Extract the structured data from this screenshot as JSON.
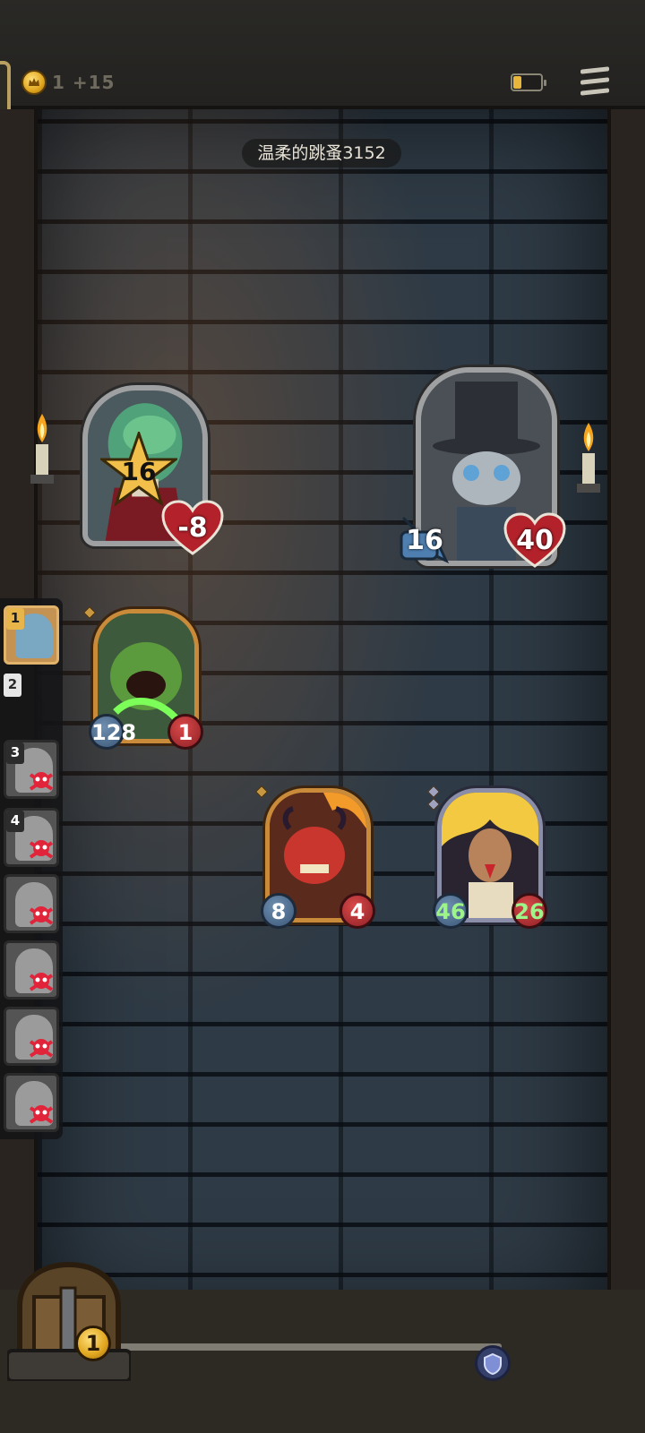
{
  "top_bar": {
    "gold_text": "1 +15",
    "battery_level": 0.3,
    "icons": [
      "gold-coin-icon",
      "battery-icon",
      "menu-icon"
    ]
  },
  "opponent": {
    "name": "温柔的跳蚤3152"
  },
  "enemy_hero": {
    "tier": "16",
    "health": "-8"
  },
  "player_hero": {
    "attack": "16",
    "health": "40"
  },
  "minions": [
    {
      "name": "green-toad-minion",
      "attack": "128",
      "health": "1",
      "attack_buffed": true,
      "health_buffed": false
    },
    {
      "name": "red-demon-minion",
      "attack": "8",
      "health": "4",
      "attack_buffed": false,
      "health_buffed": false
    },
    {
      "name": "golden-pharaoh-minion",
      "attack": "46",
      "health": "26",
      "attack_buffed": true,
      "health_buffed": true
    }
  ],
  "roster": {
    "slots": [
      {
        "rank": "1",
        "active": true,
        "eliminated": false
      },
      {
        "rank": "3",
        "active": false,
        "eliminated": true
      },
      {
        "rank": "4",
        "active": false,
        "eliminated": true
      },
      {
        "rank": "",
        "active": false,
        "eliminated": true
      },
      {
        "rank": "",
        "active": false,
        "eliminated": true
      },
      {
        "rank": "",
        "active": false,
        "eliminated": true
      },
      {
        "rank": "",
        "active": false,
        "eliminated": true
      }
    ],
    "free_rank": "2"
  },
  "shop": {
    "coin_count": "1"
  },
  "colors": {
    "gold": "#e0a51e",
    "attack_blue": "#3a5677",
    "health_red": "#8e1f24",
    "buff_green": "#9df58a"
  }
}
